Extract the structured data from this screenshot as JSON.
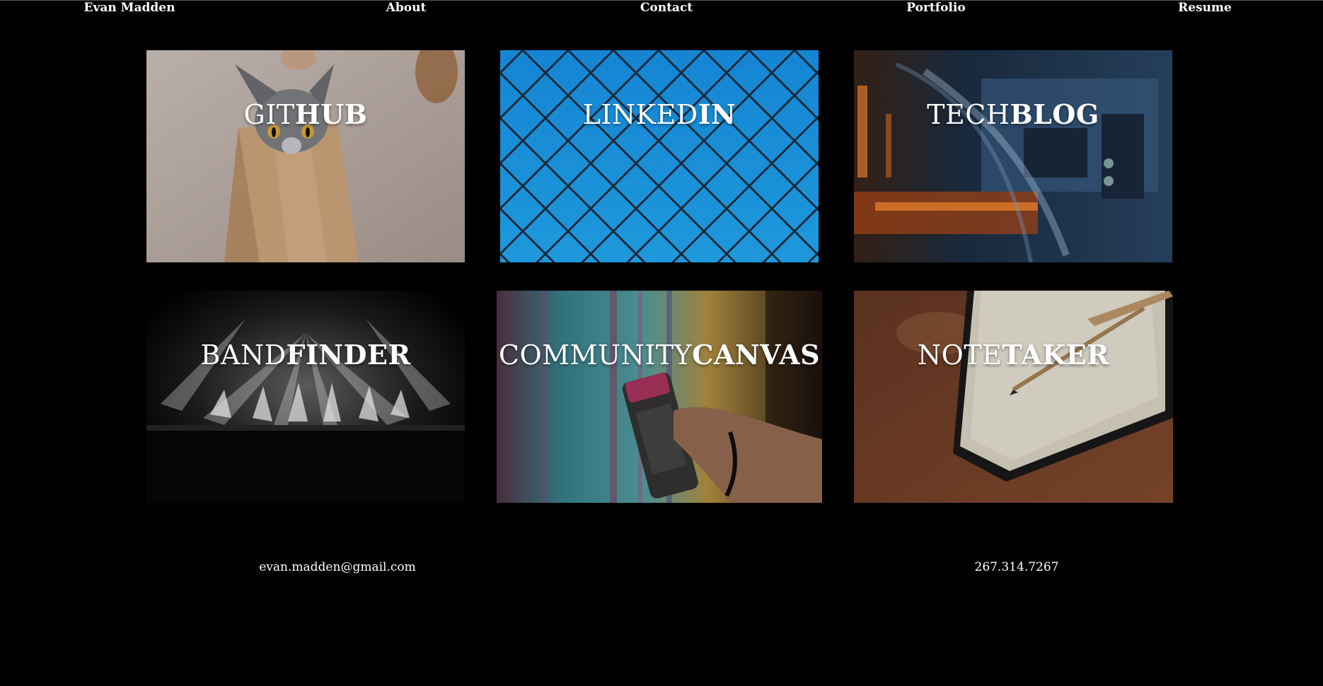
{
  "nav": {
    "brand": "Evan Madden",
    "items": [
      "About",
      "Contact",
      "Portfolio",
      "Resume"
    ]
  },
  "projects": [
    {
      "light": "GIT",
      "bold": "HUB",
      "image": "cat-in-paper-bag-photo"
    },
    {
      "light": "LINKED",
      "bold": "IN",
      "image": "chain-link-fence-photo"
    },
    {
      "light": "TECH",
      "bold": "BLOG",
      "image": "circuit-board-photo"
    },
    {
      "light": "BAND",
      "bold": "FINDER",
      "image": "concert-stage-lights-photo"
    },
    {
      "light": "COMMUNITY",
      "bold": "CANVAS",
      "image": "spray-paint-graffiti-photo"
    },
    {
      "light": "NOTE",
      "bold": "TAKER",
      "image": "open-notebook-pencil-photo"
    }
  ],
  "footer": {
    "email": "evan.madden@gmail.com",
    "phone": "267.314.7267"
  },
  "colors": {
    "background": "#000000",
    "text": "#ffffff",
    "linkedin_blue": "#1b8fd6"
  }
}
